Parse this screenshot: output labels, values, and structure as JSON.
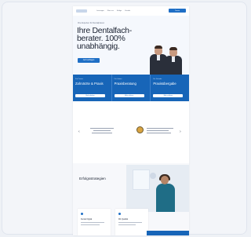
{
  "nav": {
    "items": [
      "Leistungen",
      "Über uns",
      "Erfolge",
      "Kontakt"
    ],
    "cta": "Termin"
  },
  "hero": {
    "kicker": "Ihre Experten für Dentalpraxen",
    "title": "Ihre Dentalfach-berater. 100% unabhängig.",
    "button": "Jetzt anfragen"
  },
  "band": {
    "columns": [
      {
        "small": "Für Praxen",
        "title": "Zahnärzte & Praxis",
        "button": "Mehr erfahren"
      },
      {
        "small": "Für Labore",
        "title": "Praxisberatung",
        "button": "Mehr erfahren"
      },
      {
        "small": "Für Gründer",
        "title": "Praxisübergabe",
        "button": "Mehr erfahren"
      }
    ]
  },
  "success": {
    "title": "Erfolgsstrategien",
    "cards": [
      {
        "title": "Dental Digital"
      },
      {
        "title": "Mit Qualität"
      }
    ]
  },
  "colors": {
    "primary": "#1765b8",
    "accent": "#1f6fc6",
    "page": "#ffffff",
    "background": "#eef1f6"
  }
}
